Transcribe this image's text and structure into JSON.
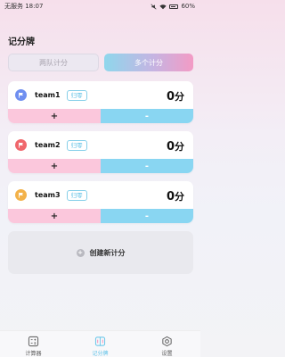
{
  "status_bar": {
    "carrier_time": "无服务 18:07",
    "battery": "60%"
  },
  "page_title": "记分牌",
  "mode_tabs": [
    {
      "label": "两队计分",
      "active": false
    },
    {
      "label": "多个计分",
      "active": true
    }
  ],
  "teams": [
    {
      "name": "team1",
      "score": "0",
      "unit": "分",
      "reset_label": "归零",
      "flag_color": "#6f8ff0",
      "plus": "+",
      "minus": "-"
    },
    {
      "name": "team2",
      "score": "0",
      "unit": "分",
      "reset_label": "归零",
      "flag_color": "#f0676c",
      "plus": "+",
      "minus": "-"
    },
    {
      "name": "team3",
      "score": "0",
      "unit": "分",
      "reset_label": "归零",
      "flag_color": "#f3b24a",
      "plus": "+",
      "minus": "-"
    }
  ],
  "create_button": {
    "icon": "plus-icon",
    "label": "创建新计分"
  },
  "bottom_nav": [
    {
      "label": "计算器",
      "icon": "calculator-icon",
      "active": false
    },
    {
      "label": "记分牌",
      "icon": "scoreboard-icon",
      "active": true
    },
    {
      "label": "设置",
      "icon": "settings-icon",
      "active": false
    }
  ],
  "colors": {
    "accent_blue": "#89d6f2",
    "accent_pink": "#fbc7dc"
  }
}
